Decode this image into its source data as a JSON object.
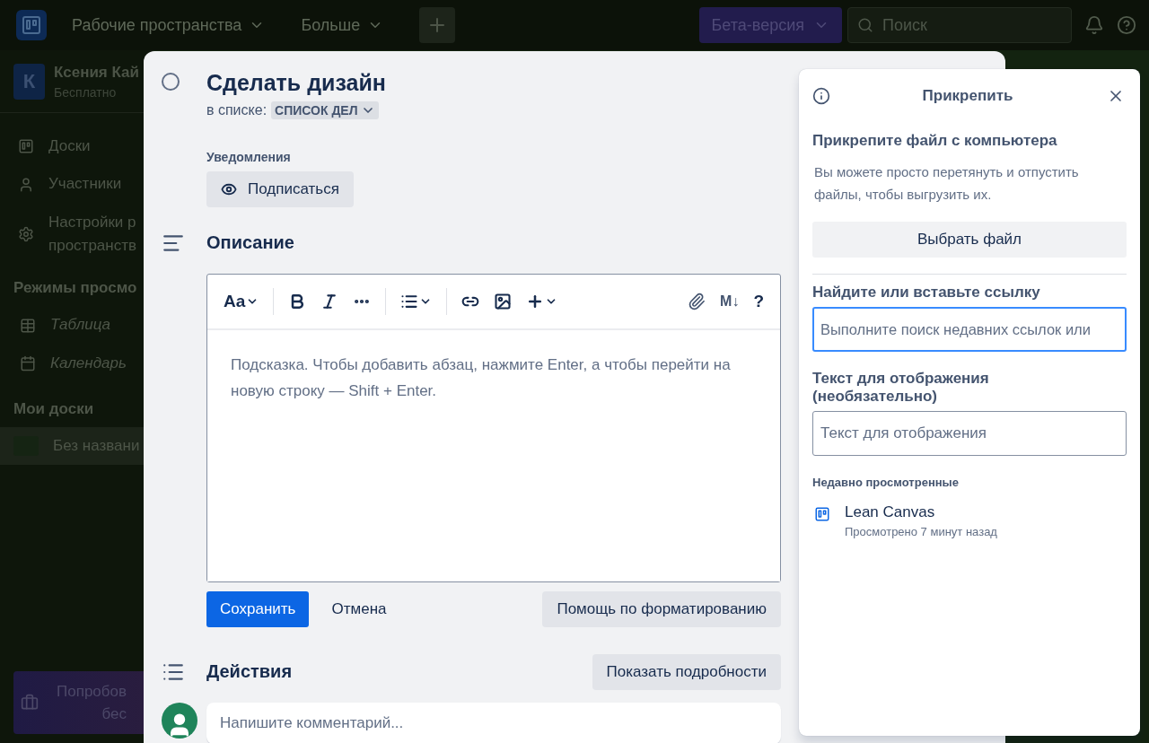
{
  "topbar": {
    "menus": [
      {
        "label": "Рабочие пространства"
      },
      {
        "label": "Больше"
      }
    ],
    "beta": "Бета-версия",
    "search": {
      "placeholder": "Поиск"
    }
  },
  "sidebar": {
    "workspace": {
      "initial": "К",
      "name": "Ксения Кай",
      "plan": "Бесплатно"
    },
    "nav": [
      {
        "label": "Доски",
        "kind": "boards"
      },
      {
        "label": "Участники",
        "kind": "members"
      },
      {
        "label": "Настройки р\nпространств",
        "kind": "settings"
      }
    ],
    "views_heading": "Режимы просмо",
    "views": [
      {
        "label": "Таблица",
        "kind": "table"
      },
      {
        "label": "Календарь",
        "kind": "calendar"
      }
    ],
    "boards_heading": "Мои доски",
    "boards": [
      {
        "label": "Без названи",
        "selected": true
      }
    ],
    "promo": "Попробов\nбес"
  },
  "card": {
    "title": "Сделать дизайн",
    "in_list_label": "в списке:",
    "list_name": "СПИСОК ДЕЛ",
    "completed": false,
    "notifications_label": "Уведомления",
    "watch_button": "Подписаться",
    "description_heading": "Описание",
    "editor": {
      "toolbar": [
        {
          "kind": "text-style",
          "label": "Aa"
        },
        {
          "kind": "divider"
        },
        {
          "kind": "bold"
        },
        {
          "kind": "italic"
        },
        {
          "kind": "more"
        },
        {
          "kind": "divider"
        },
        {
          "kind": "list"
        },
        {
          "kind": "divider"
        },
        {
          "kind": "link"
        },
        {
          "kind": "image"
        },
        {
          "kind": "insert"
        },
        {
          "kind": "spacer"
        },
        {
          "kind": "attach"
        },
        {
          "kind": "markdown",
          "label": "M↓"
        },
        {
          "kind": "help",
          "label": "?"
        }
      ],
      "placeholder": "Подсказка. Чтобы добавить абзац, нажмите Enter, а чтобы перейти на новую строку — Shift + Enter."
    },
    "save": "Сохранить",
    "cancel": "Отмена",
    "help": "Помощь по форматированию",
    "activity_heading": "Действия",
    "show_details": "Показать подробности",
    "comment": {
      "placeholder": "Напишите комментарий..."
    }
  },
  "popover": {
    "title": "Прикрепить",
    "upload_heading": "Прикрепите файл с компьютера",
    "upload_hint": "Вы можете просто перетянуть и отпустить файлы, чтобы выгрузить их.",
    "choose_button": "Выбрать файл",
    "link_label": "Найдите или вставьте ссылку",
    "link_field": {
      "placeholder": "Выполните поиск недавних ссылок или",
      "focused": true
    },
    "display_label": "Текст для отображения (необязательно)",
    "display_field": {
      "placeholder": "Текст для отображения",
      "focused": false
    },
    "recent_heading": "Недавно просмотренные",
    "recent": [
      {
        "title": "Lean Canvas",
        "meta": "Просмотрено 7 минут назад"
      }
    ]
  }
}
